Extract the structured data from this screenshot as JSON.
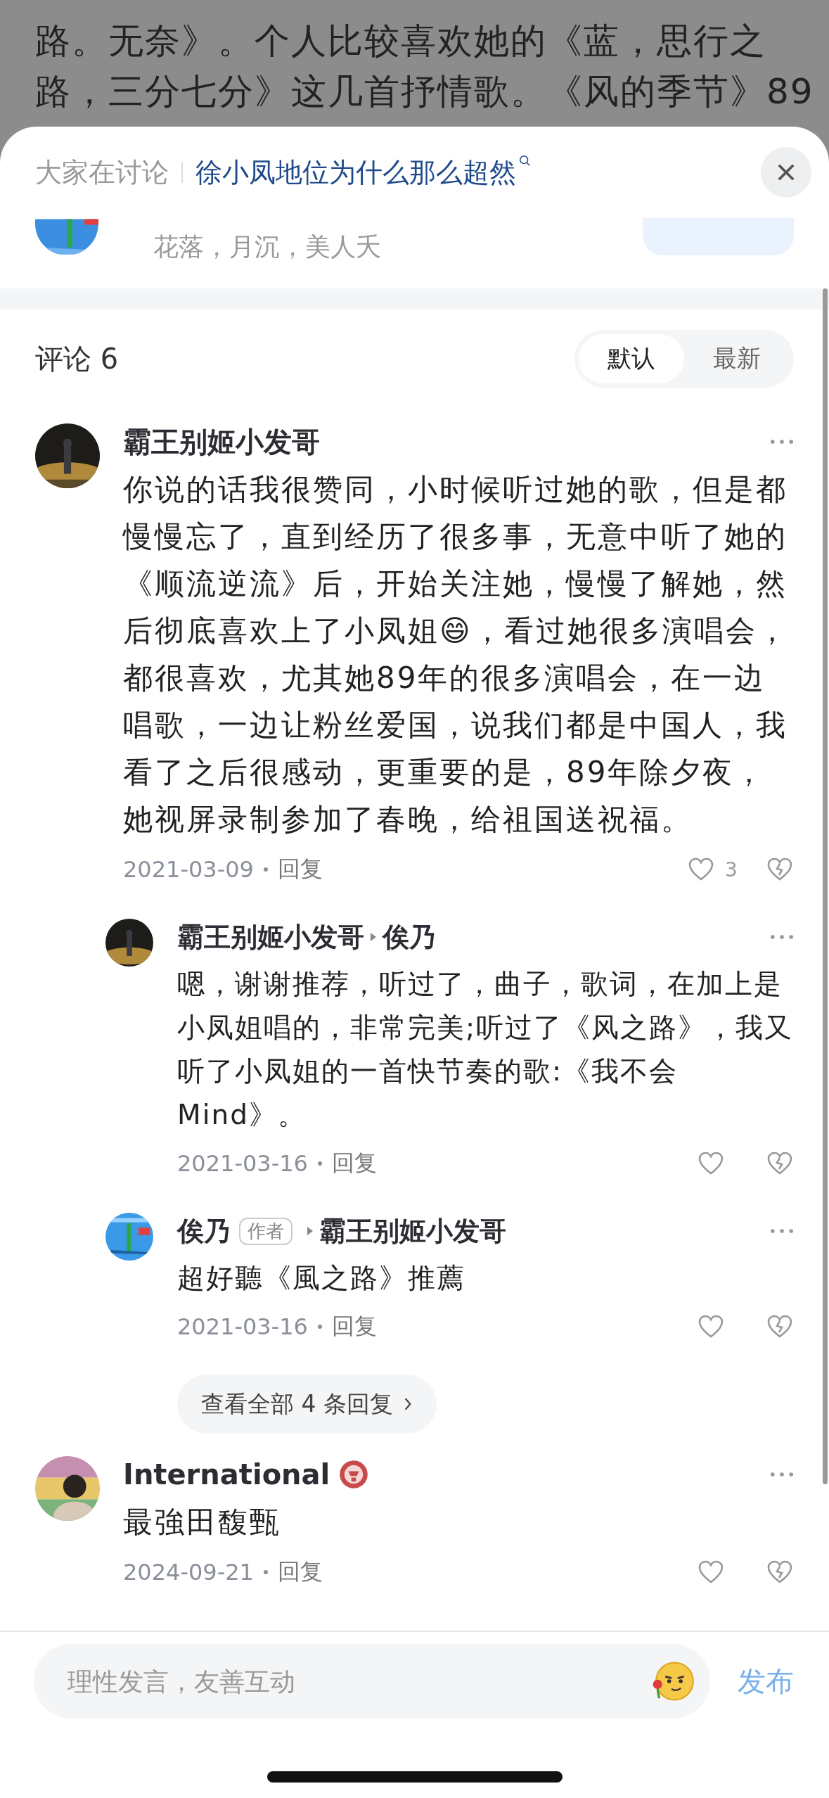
{
  "background_article": {
    "lines": [
      "路。无奈》。个人比较喜欢她的《蓝，思行之",
      "路，三分七分》这几首抒情歌。《风的季节》89"
    ]
  },
  "sheet_header": {
    "label": "大家在讨论",
    "topic": "徐小凤地位为什么那么超然"
  },
  "author_row": {
    "subtitle": "花落，月沉，美人夭"
  },
  "comments_header": {
    "title": "评论 6",
    "sort_tabs": [
      {
        "label": "默认",
        "selected": true
      },
      {
        "label": "最新",
        "selected": false
      }
    ]
  },
  "comments": [
    {
      "author": "霸王别姬小发哥",
      "has_badge": false,
      "text": "你说的话我很赞同，小时候听过她的歌，但是都慢慢忘了，直到经历了很多事，无意中听了她的《顺流逆流》后，开始关注她，慢慢了解她，然后彻底喜欢上了小凤姐😄，看过她很多演唱会，都很喜欢，尤其她89年的很多演唱会，在一边唱歌，一边让粉丝爱国，说我们都是中国人，我看了之后很感动，更重要的是，89年除夕夜，她视屏录制参加了春晚，给祖国送祝福。",
      "date": "2021-03-09",
      "reply_label": "回复",
      "like_count": "3",
      "replies": [
        {
          "author": "霸王别姬小发哥",
          "reply_to": "俟乃",
          "text": "嗯，谢谢推荐，听过了，曲子，歌词，在加上是小凤姐唱的，非常完美;听过了《风之路》，我又听了小凤姐的一首快节奏的歌:《我不会Mind》。",
          "date": "2021-03-16",
          "reply_label": "回复"
        },
        {
          "author": "俟乃",
          "tag": "作者",
          "reply_to": "霸王别姬小发哥",
          "text": "超好聽《風之路》推薦",
          "date": "2021-03-16",
          "reply_label": "回复"
        }
      ],
      "more_replies": "查看全部 4 条回复"
    },
    {
      "author": "International",
      "has_badge": true,
      "text": "最強田馥甄",
      "date": "2024-09-21",
      "reply_label": "回复"
    }
  ],
  "composer": {
    "placeholder": "理性发言，友善互动",
    "submit": "发布"
  }
}
